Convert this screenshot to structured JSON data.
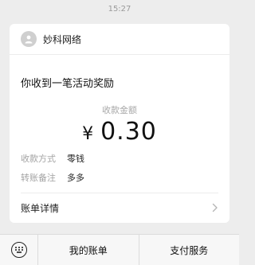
{
  "timestamp": "15:27",
  "card": {
    "brand_name": "妙科网络",
    "title": "你收到一笔活动奖励",
    "amount_label": "收款金额",
    "currency_symbol": "¥",
    "amount": "0.30",
    "fields": [
      {
        "key": "收款方式",
        "value": "零钱"
      },
      {
        "key": "转账备注",
        "value": "多多"
      }
    ],
    "details_label": "账单详情"
  },
  "toolbar": {
    "keyboard_icon": "keyboard-icon",
    "my_bill_label": "我的账单",
    "payment_service_label": "支付服务"
  }
}
